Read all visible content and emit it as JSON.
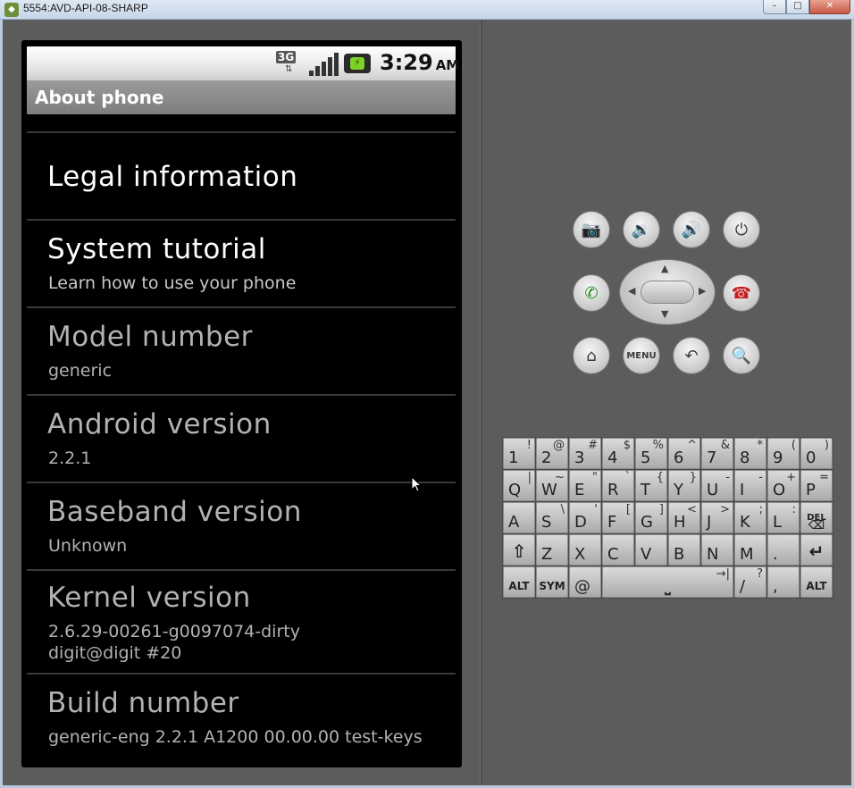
{
  "window": {
    "title": "5554:AVD-API-08-SHARP",
    "minimize": "–",
    "maximize": "□",
    "close": "✕"
  },
  "status_bar": {
    "network": "3G",
    "network_arrows": "⇅",
    "time": "3:29",
    "ampm": "AM"
  },
  "app": {
    "title": "About phone"
  },
  "list": [
    {
      "title": "Legal information",
      "summary": "",
      "enabled": true
    },
    {
      "title": "System tutorial",
      "summary": "Learn how to use your phone",
      "enabled": true
    },
    {
      "title": "Model number",
      "summary": "generic",
      "enabled": false
    },
    {
      "title": "Android version",
      "summary": "2.2.1",
      "enabled": false
    },
    {
      "title": "Baseband version",
      "summary": "Unknown",
      "enabled": false
    },
    {
      "title": "Kernel version",
      "summary": "2.6.29-00261-g0097074-dirty",
      "summary2": "digit@digit #20",
      "enabled": false
    },
    {
      "title": "Build number",
      "summary": "generic-eng 2.2.1 A1200 00.00.00 test-keys",
      "enabled": false
    }
  ],
  "controls": {
    "menu_label": "MENU",
    "icons": [
      "camera-icon",
      "volume-down-icon",
      "volume-up-icon",
      "power-icon",
      "call-icon",
      "end-call-icon",
      "home-icon",
      "back-icon",
      "search-icon"
    ]
  },
  "keyboard": {
    "row1": [
      [
        "1",
        "!"
      ],
      [
        "2",
        "@"
      ],
      [
        "3",
        "#"
      ],
      [
        "4",
        "$"
      ],
      [
        "5",
        "%"
      ],
      [
        "6",
        "^"
      ],
      [
        "7",
        "&"
      ],
      [
        "8",
        "*"
      ],
      [
        "9",
        "("
      ],
      [
        "0",
        ")"
      ]
    ],
    "row2": [
      [
        "Q",
        "|"
      ],
      [
        "W",
        "~"
      ],
      [
        "E",
        "\""
      ],
      [
        "R",
        "`"
      ],
      [
        "T",
        "{"
      ],
      [
        "Y",
        "}"
      ],
      [
        "U",
        "-"
      ],
      [
        "I",
        "-"
      ],
      [
        "O",
        "+"
      ],
      [
        "P",
        "="
      ]
    ],
    "row3": [
      [
        "A",
        ""
      ],
      [
        "S",
        "\\"
      ],
      [
        "D",
        "'"
      ],
      [
        "F",
        "["
      ],
      [
        "G",
        "]"
      ],
      [
        "H",
        "<"
      ],
      [
        "J",
        ">"
      ],
      [
        "K",
        ";"
      ],
      [
        "L",
        ":"
      ],
      [
        "DEL",
        ""
      ]
    ],
    "row4": [
      [
        "⇧",
        ""
      ],
      [
        "Z",
        ""
      ],
      [
        "X",
        ""
      ],
      [
        "C",
        ""
      ],
      [
        "V",
        ""
      ],
      [
        "B",
        ""
      ],
      [
        "N",
        ""
      ],
      [
        "M",
        ""
      ],
      [
        ".",
        ""
      ],
      [
        "↵",
        ""
      ]
    ],
    "row5": {
      "alt_left": "ALT",
      "sym": "SYM",
      "at": "@",
      "space": "⎵",
      "tab": "→|",
      "slash": "/",
      "question": "?",
      "comma": ",",
      "alt_right": "ALT"
    }
  }
}
